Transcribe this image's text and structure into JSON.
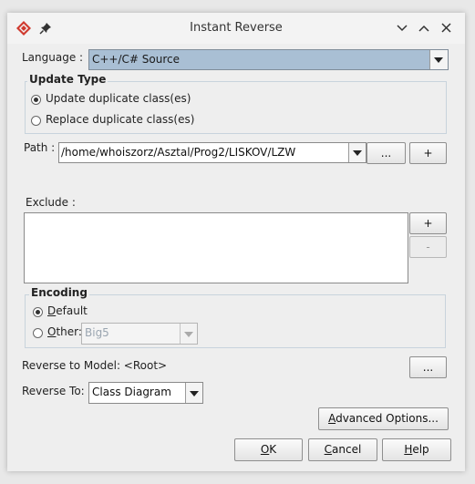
{
  "window": {
    "title": "Instant Reverse"
  },
  "language": {
    "label": "Language :",
    "value": "C++/C# Source"
  },
  "update_type": {
    "legend": "Update Type",
    "options": [
      {
        "label": "Update duplicate class(es)",
        "selected": true
      },
      {
        "label": "Replace duplicate class(es)",
        "selected": false
      }
    ]
  },
  "path": {
    "label": "Path :",
    "value": "/home/whoiszorz/Asztal/Prog2/LISKOV/LZW",
    "browse_label": "...",
    "add_label": "+"
  },
  "exclude": {
    "label": "Exclude :",
    "add_label": "+",
    "remove_label": "-"
  },
  "encoding": {
    "legend": "Encoding",
    "default_prefix": "",
    "default_mnemonic": "D",
    "default_rest": "efault",
    "other_prefix": "",
    "other_mnemonic": "O",
    "other_rest": "ther:",
    "other_value": "Big5"
  },
  "reverse_model": {
    "label": "Reverse to Model: <Root>",
    "button_label": "..."
  },
  "reverse_to": {
    "label": "Reverse To:",
    "value": "Class Diagram"
  },
  "buttons": {
    "advanced_mnemonic": "A",
    "advanced_rest": "dvanced Options...",
    "ok_mnemonic": "O",
    "ok_rest": "K",
    "cancel_mnemonic": "C",
    "cancel_rest": "ancel",
    "help_mnemonic": "H",
    "help_rest": "elp"
  },
  "colors": {
    "accent": "#a9bfd4",
    "group_border": "#c8d3dc"
  }
}
